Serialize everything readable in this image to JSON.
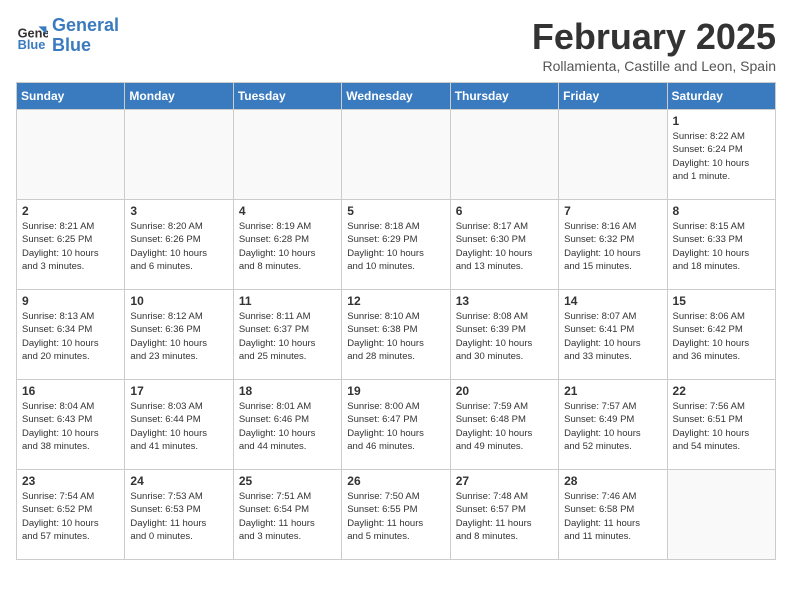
{
  "header": {
    "logo_general": "General",
    "logo_blue": "Blue",
    "month_title": "February 2025",
    "location": "Rollamienta, Castille and Leon, Spain"
  },
  "days_of_week": [
    "Sunday",
    "Monday",
    "Tuesday",
    "Wednesday",
    "Thursday",
    "Friday",
    "Saturday"
  ],
  "weeks": [
    [
      {
        "day": "",
        "info": ""
      },
      {
        "day": "",
        "info": ""
      },
      {
        "day": "",
        "info": ""
      },
      {
        "day": "",
        "info": ""
      },
      {
        "day": "",
        "info": ""
      },
      {
        "day": "",
        "info": ""
      },
      {
        "day": "1",
        "info": "Sunrise: 8:22 AM\nSunset: 6:24 PM\nDaylight: 10 hours\nand 1 minute."
      }
    ],
    [
      {
        "day": "2",
        "info": "Sunrise: 8:21 AM\nSunset: 6:25 PM\nDaylight: 10 hours\nand 3 minutes."
      },
      {
        "day": "3",
        "info": "Sunrise: 8:20 AM\nSunset: 6:26 PM\nDaylight: 10 hours\nand 6 minutes."
      },
      {
        "day": "4",
        "info": "Sunrise: 8:19 AM\nSunset: 6:28 PM\nDaylight: 10 hours\nand 8 minutes."
      },
      {
        "day": "5",
        "info": "Sunrise: 8:18 AM\nSunset: 6:29 PM\nDaylight: 10 hours\nand 10 minutes."
      },
      {
        "day": "6",
        "info": "Sunrise: 8:17 AM\nSunset: 6:30 PM\nDaylight: 10 hours\nand 13 minutes."
      },
      {
        "day": "7",
        "info": "Sunrise: 8:16 AM\nSunset: 6:32 PM\nDaylight: 10 hours\nand 15 minutes."
      },
      {
        "day": "8",
        "info": "Sunrise: 8:15 AM\nSunset: 6:33 PM\nDaylight: 10 hours\nand 18 minutes."
      }
    ],
    [
      {
        "day": "9",
        "info": "Sunrise: 8:13 AM\nSunset: 6:34 PM\nDaylight: 10 hours\nand 20 minutes."
      },
      {
        "day": "10",
        "info": "Sunrise: 8:12 AM\nSunset: 6:36 PM\nDaylight: 10 hours\nand 23 minutes."
      },
      {
        "day": "11",
        "info": "Sunrise: 8:11 AM\nSunset: 6:37 PM\nDaylight: 10 hours\nand 25 minutes."
      },
      {
        "day": "12",
        "info": "Sunrise: 8:10 AM\nSunset: 6:38 PM\nDaylight: 10 hours\nand 28 minutes."
      },
      {
        "day": "13",
        "info": "Sunrise: 8:08 AM\nSunset: 6:39 PM\nDaylight: 10 hours\nand 30 minutes."
      },
      {
        "day": "14",
        "info": "Sunrise: 8:07 AM\nSunset: 6:41 PM\nDaylight: 10 hours\nand 33 minutes."
      },
      {
        "day": "15",
        "info": "Sunrise: 8:06 AM\nSunset: 6:42 PM\nDaylight: 10 hours\nand 36 minutes."
      }
    ],
    [
      {
        "day": "16",
        "info": "Sunrise: 8:04 AM\nSunset: 6:43 PM\nDaylight: 10 hours\nand 38 minutes."
      },
      {
        "day": "17",
        "info": "Sunrise: 8:03 AM\nSunset: 6:44 PM\nDaylight: 10 hours\nand 41 minutes."
      },
      {
        "day": "18",
        "info": "Sunrise: 8:01 AM\nSunset: 6:46 PM\nDaylight: 10 hours\nand 44 minutes."
      },
      {
        "day": "19",
        "info": "Sunrise: 8:00 AM\nSunset: 6:47 PM\nDaylight: 10 hours\nand 46 minutes."
      },
      {
        "day": "20",
        "info": "Sunrise: 7:59 AM\nSunset: 6:48 PM\nDaylight: 10 hours\nand 49 minutes."
      },
      {
        "day": "21",
        "info": "Sunrise: 7:57 AM\nSunset: 6:49 PM\nDaylight: 10 hours\nand 52 minutes."
      },
      {
        "day": "22",
        "info": "Sunrise: 7:56 AM\nSunset: 6:51 PM\nDaylight: 10 hours\nand 54 minutes."
      }
    ],
    [
      {
        "day": "23",
        "info": "Sunrise: 7:54 AM\nSunset: 6:52 PM\nDaylight: 10 hours\nand 57 minutes."
      },
      {
        "day": "24",
        "info": "Sunrise: 7:53 AM\nSunset: 6:53 PM\nDaylight: 11 hours\nand 0 minutes."
      },
      {
        "day": "25",
        "info": "Sunrise: 7:51 AM\nSunset: 6:54 PM\nDaylight: 11 hours\nand 3 minutes."
      },
      {
        "day": "26",
        "info": "Sunrise: 7:50 AM\nSunset: 6:55 PM\nDaylight: 11 hours\nand 5 minutes."
      },
      {
        "day": "27",
        "info": "Sunrise: 7:48 AM\nSunset: 6:57 PM\nDaylight: 11 hours\nand 8 minutes."
      },
      {
        "day": "28",
        "info": "Sunrise: 7:46 AM\nSunset: 6:58 PM\nDaylight: 11 hours\nand 11 minutes."
      },
      {
        "day": "",
        "info": ""
      }
    ]
  ]
}
